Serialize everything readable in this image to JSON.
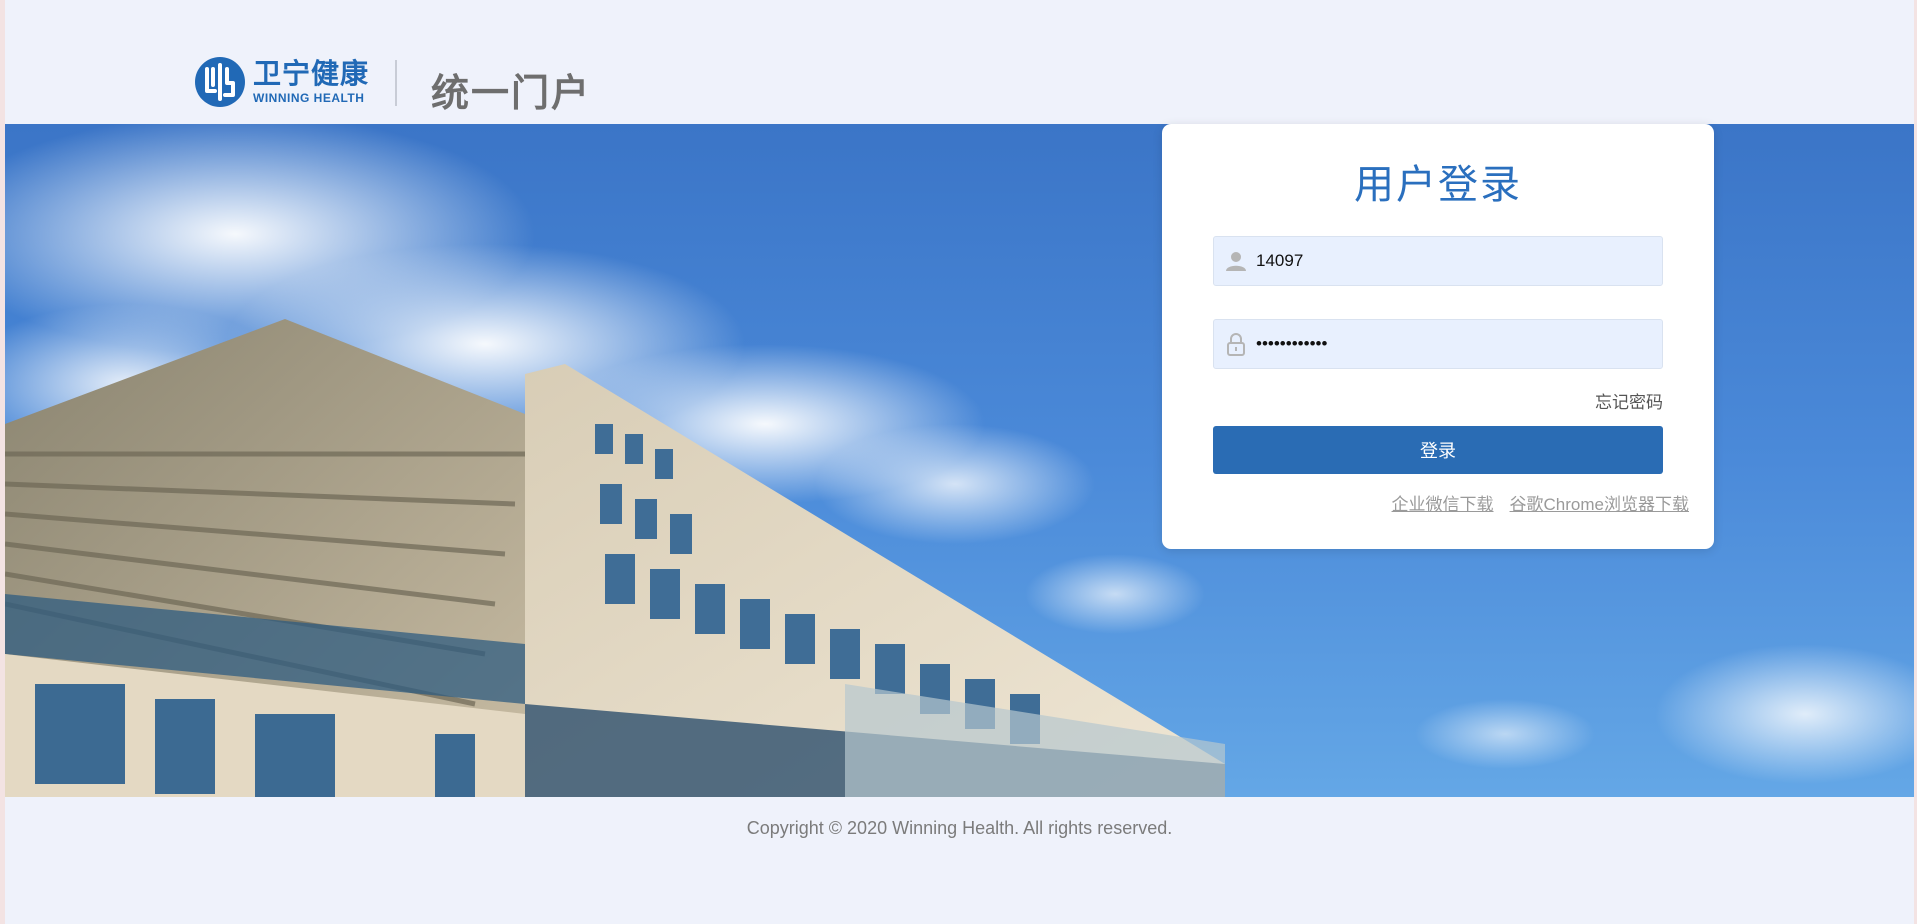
{
  "header": {
    "logo_cn": "卫宁健康",
    "logo_en": "WINNING HEALTH",
    "portal_title": "统一门户"
  },
  "login": {
    "title": "用户登录",
    "username_value": "14097",
    "password_value": "••••••••••••",
    "forgot_password": "忘记密码",
    "login_button": "登录",
    "link_wechat": "企业微信下载",
    "link_chrome": "谷歌Chrome浏览器下载"
  },
  "footer": {
    "copyright": "Copyright © 2020 Winning Health. All rights reserved."
  },
  "colors": {
    "brand_blue": "#2169b6",
    "button_blue": "#2a6cb4",
    "page_bg": "#eff2fb",
    "field_bg": "#e8f0fe"
  },
  "icons": {
    "username": "user-icon",
    "password": "lock-icon"
  }
}
